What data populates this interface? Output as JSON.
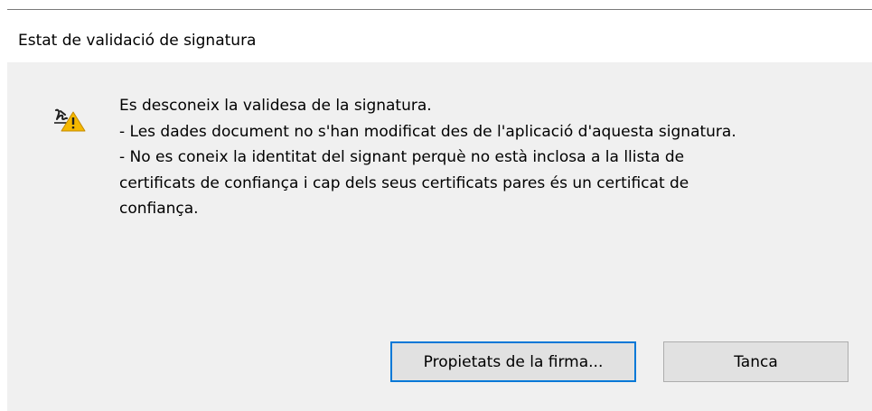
{
  "dialog": {
    "title": "Estat de validació de signatura",
    "icon": "signature-warning-icon",
    "message_lines": [
      "Es desconeix la validesa de la signatura.",
      "- Les dades document no s'han modificat des de l'aplicació d'aquesta signatura.",
      "- No es coneix la identitat del signant perquè no està inclosa a la llista de",
      "certificats de confiança i cap dels seus certificats pares és un certificat de",
      "confiança."
    ],
    "buttons": {
      "properties_label": "Propietats de la firma...",
      "close_label": "Tanca"
    }
  },
  "colors": {
    "title_background": "#ffffff",
    "body_background": "#f0f0f0",
    "button_background": "#e1e1e1",
    "focus_border": "#0078d7",
    "warning": "#f5b800"
  }
}
